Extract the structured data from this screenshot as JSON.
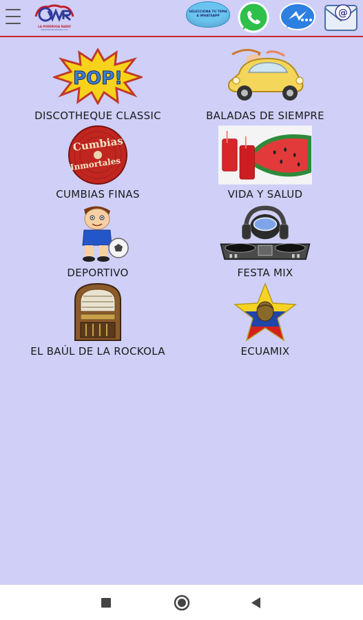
{
  "header": {
    "menu_icon": "hamburger-menu-icon",
    "logo_tagline": "LA PODEROSA RADIO",
    "logo_url": "www.lapoderosaradio.com",
    "bubble_text_1": "SELECCIONA TU TEMA",
    "bubble_text_2": "A WHATSAPP",
    "accent_line_color": "#d0232f",
    "icons": [
      "whatsapp-icon",
      "messenger-icon",
      "email-icon"
    ]
  },
  "stations": [
    {
      "label": "DISCOTHEQUE CLASSIC",
      "icon": "pop-burst-icon"
    },
    {
      "label": "BALADAS DE SIEMPRE",
      "icon": "vintage-car-icon"
    },
    {
      "label": "CUMBIAS FINAS",
      "icon": "cumbias-disc-icon",
      "disc_text_1": "Cumbias",
      "disc_text_2": "Inmortales"
    },
    {
      "label": "VIDA Y SALUD",
      "icon": "watermelon-juice-icon"
    },
    {
      "label": "DEPORTIVO",
      "icon": "soccer-kid-icon"
    },
    {
      "label": "FESTA MIX",
      "icon": "dj-headphones-icon"
    },
    {
      "label": "EL BAÚL DE LA ROCKOLA",
      "icon": "jukebox-icon"
    },
    {
      "label": "ECUAMIX",
      "icon": "ecuador-flag-star-icon"
    }
  ],
  "pop_text": "POP!",
  "colors": {
    "background": "#cfcff7",
    "navbar": "#ffffff"
  }
}
